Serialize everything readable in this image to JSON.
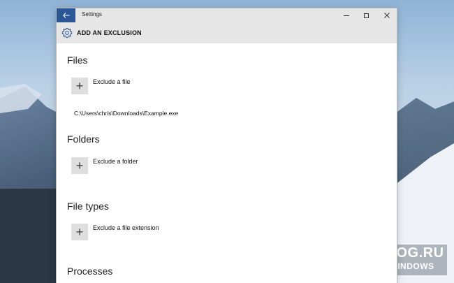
{
  "window": {
    "title": "Settings",
    "back_icon": "back-arrow-icon",
    "controls": [
      "minimize-icon",
      "maximize-icon",
      "close-icon"
    ],
    "accent_color": "#2b5797"
  },
  "header": {
    "icon": "gear-icon",
    "title": "ADD AN EXCLUSION"
  },
  "sections": {
    "files": {
      "title": "Files",
      "add_label": "Exclude a file",
      "items": [
        "C:\\Users\\chris\\Downloads\\Example.exe"
      ]
    },
    "folders": {
      "title": "Folders",
      "add_label": "Exclude a folder"
    },
    "file_types": {
      "title": "File types",
      "add_label": "Exclude a file extension"
    },
    "processes": {
      "title": "Processes"
    }
  },
  "watermark": {
    "title": "WINBLOG.RU",
    "subtitle": "ВСЁ О WINDOWS"
  }
}
